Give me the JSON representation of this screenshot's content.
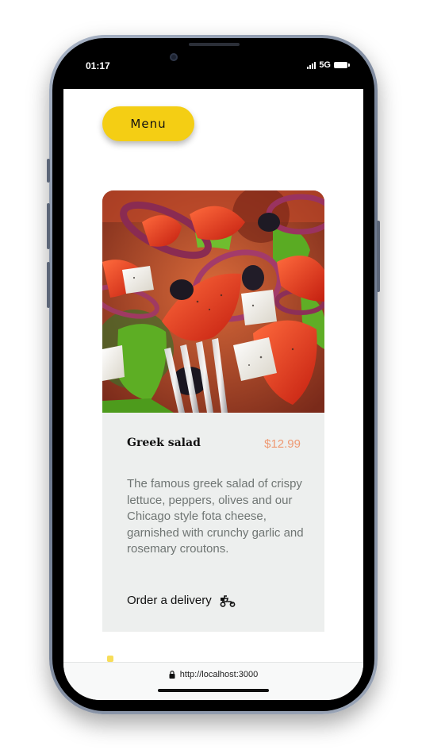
{
  "status_bar": {
    "time": "01:17",
    "network": "5G"
  },
  "menu_button": {
    "label": "Menu"
  },
  "card": {
    "title": "Greek salad",
    "price": "$12.99",
    "description": "The famous greek salad of crispy lettuce, peppers, olives and our Chicago style fota cheese, garnished with crunchy garlic and rosemary croutons.",
    "order_label": "Order a delivery",
    "order_icon": "scooter-icon",
    "image_subject": "greek-salad-photo"
  },
  "browser": {
    "url": "http://localhost:3000",
    "lock_icon": "lock-icon"
  },
  "colors": {
    "primary_yellow": "#f4ce14",
    "card_background": "#edefee",
    "price_color": "#ee9972",
    "description_color": "#6f7573"
  }
}
